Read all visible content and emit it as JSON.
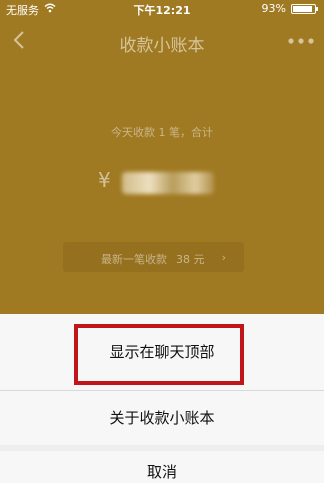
{
  "status_bar": {
    "carrier": "无服务",
    "time": "下午12:21",
    "battery": "93%",
    "wifi_icon": "wifi-icon",
    "battery_icon": "battery-icon"
  },
  "nav": {
    "back_icon": "chevron-left-icon",
    "title": "收款小账本",
    "more_icon": "more-dots-icon"
  },
  "summary": {
    "text": "今天收款 1 笔，合计",
    "currency_symbol": "¥"
  },
  "latest": {
    "label": "最新一笔收款",
    "value": "38 元",
    "arrow": "›"
  },
  "action_sheet": {
    "show_on_top": "显示在聊天顶部",
    "about": "关于收款小账本",
    "cancel": "取消"
  },
  "colors": {
    "background": "#a07a22",
    "sheet": "#f7f7f7",
    "highlight": "#c0161b"
  }
}
